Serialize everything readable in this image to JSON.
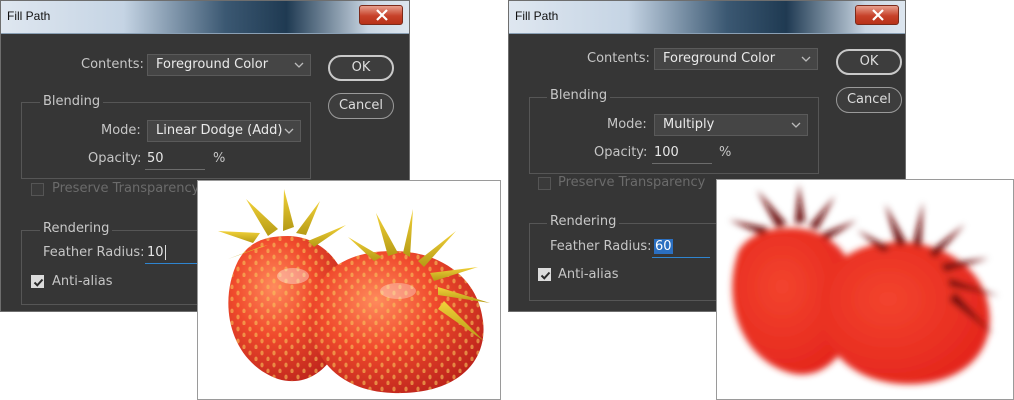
{
  "left_dialog": {
    "title": "Fill Path",
    "contents_label": "Contents:",
    "contents_value": "Foreground Color",
    "ok_label": "OK",
    "cancel_label": "Cancel",
    "blending_title": "Blending",
    "mode_label": "Mode:",
    "mode_value": "Linear Dodge (Add)",
    "opacity_label": "Opacity:",
    "opacity_value": "50",
    "opacity_unit": "%",
    "preserve_label": "Preserve Transparency",
    "rendering_title": "Rendering",
    "feather_label": "Feather Radius:",
    "feather_value": "10",
    "antialias_label": "Anti-alias"
  },
  "right_dialog": {
    "title": "Fill Path",
    "contents_label": "Contents:",
    "contents_value": "Foreground Color",
    "ok_label": "OK",
    "cancel_label": "Cancel",
    "blending_title": "Blending",
    "mode_label": "Mode:",
    "mode_value": "Multiply",
    "opacity_label": "Opacity:",
    "opacity_value": "100",
    "opacity_unit": "%",
    "preserve_label": "Preserve Transparency",
    "rendering_title": "Rendering",
    "feather_label": "Feather Radius:",
    "feather_value": "60",
    "antialias_label": "Anti-alias"
  },
  "icons": {
    "close": "close-icon",
    "dropdown": "chevron-down-icon",
    "check": "checkmark-icon"
  },
  "colors": {
    "dialog_bg": "#363636",
    "accent": "#2f85d0",
    "close_red": "#c7412a",
    "strawberry_left": "#e8402a",
    "strawberry_right": "#e8231d"
  },
  "antialias_checked": true,
  "preserve_checked": false
}
